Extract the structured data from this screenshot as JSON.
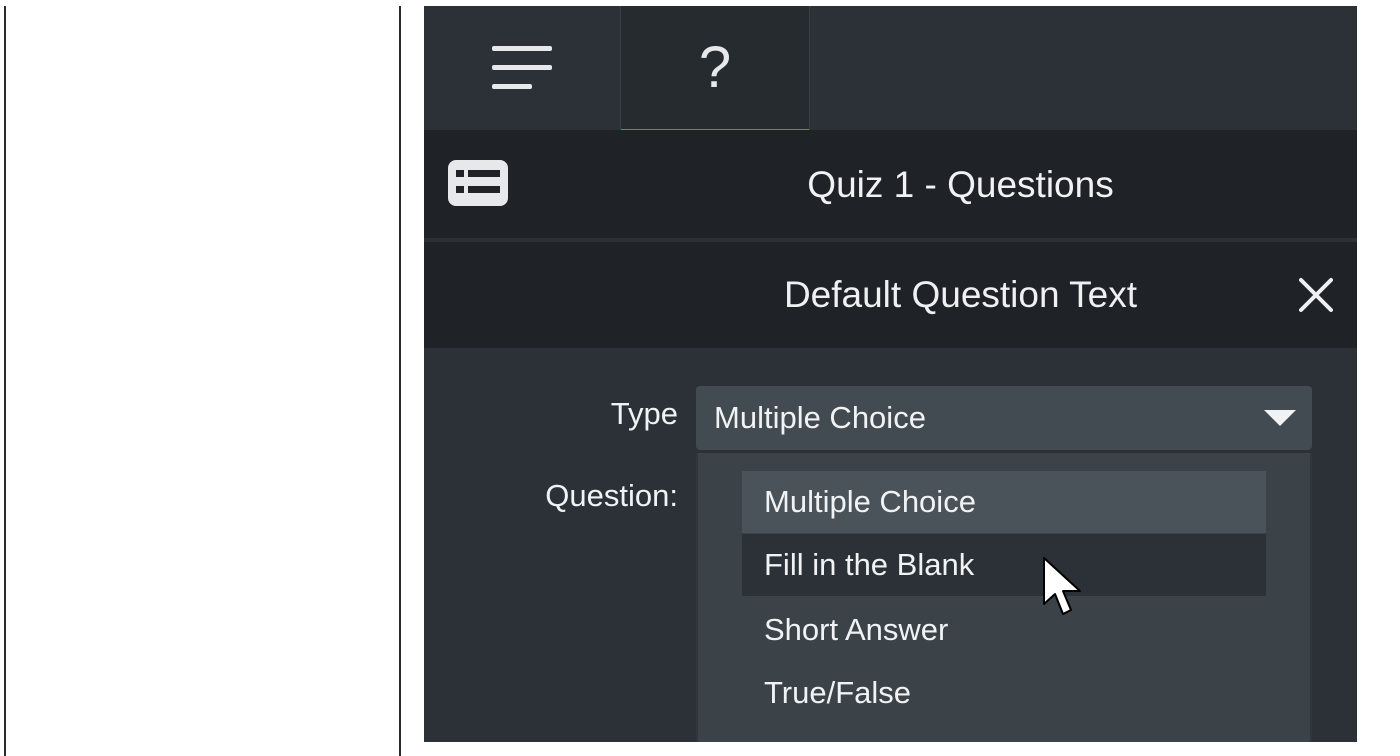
{
  "tabs": [
    {
      "label": "menu-icon"
    },
    {
      "label": "?"
    }
  ],
  "quiz": {
    "title": "Quiz 1 - Questions",
    "icon": "quiz-list-icon"
  },
  "question": {
    "title": "Default Question Text",
    "close_icon": "close-icon"
  },
  "form": {
    "type_label": "Type",
    "question_label": "Question:",
    "type_value": "Multiple Choice",
    "options": [
      "Multiple Choice",
      "Fill in the Blank",
      "Short Answer",
      "True/False"
    ],
    "selected_index": 0,
    "hovered_index": 1
  },
  "colors": {
    "accent": "#4fa31a",
    "panel_bg": "#2c3137",
    "header_bg": "#1f2327"
  }
}
